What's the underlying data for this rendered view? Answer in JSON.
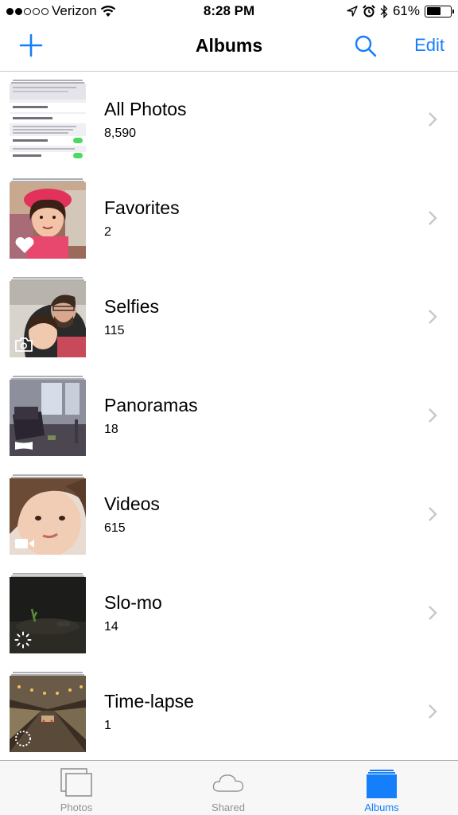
{
  "status_bar": {
    "carrier": "Verizon",
    "time": "8:28 PM",
    "battery_percent": "61%",
    "battery_level": 0.61,
    "signal_bars_filled": 2,
    "signal_bars_total": 5
  },
  "nav": {
    "title": "Albums",
    "edit_label": "Edit",
    "add_icon": "plus-icon",
    "search_icon": "search-icon"
  },
  "albums": [
    {
      "name": "All Photos",
      "count": "8,590"
    },
    {
      "name": "Favorites",
      "count": "2"
    },
    {
      "name": "Selfies",
      "count": "115"
    },
    {
      "name": "Panoramas",
      "count": "18"
    },
    {
      "name": "Videos",
      "count": "615"
    },
    {
      "name": "Slo-mo",
      "count": "14"
    },
    {
      "name": "Time-lapse",
      "count": "1"
    }
  ],
  "tabs": [
    {
      "label": "Photos",
      "active": false
    },
    {
      "label": "Shared",
      "active": false
    },
    {
      "label": "Albums",
      "active": true
    }
  ],
  "colors": {
    "accent": "#147efb",
    "tab_inactive": "#929292",
    "separator": "#c8c7cc",
    "chevron": "#c7c7cc"
  }
}
